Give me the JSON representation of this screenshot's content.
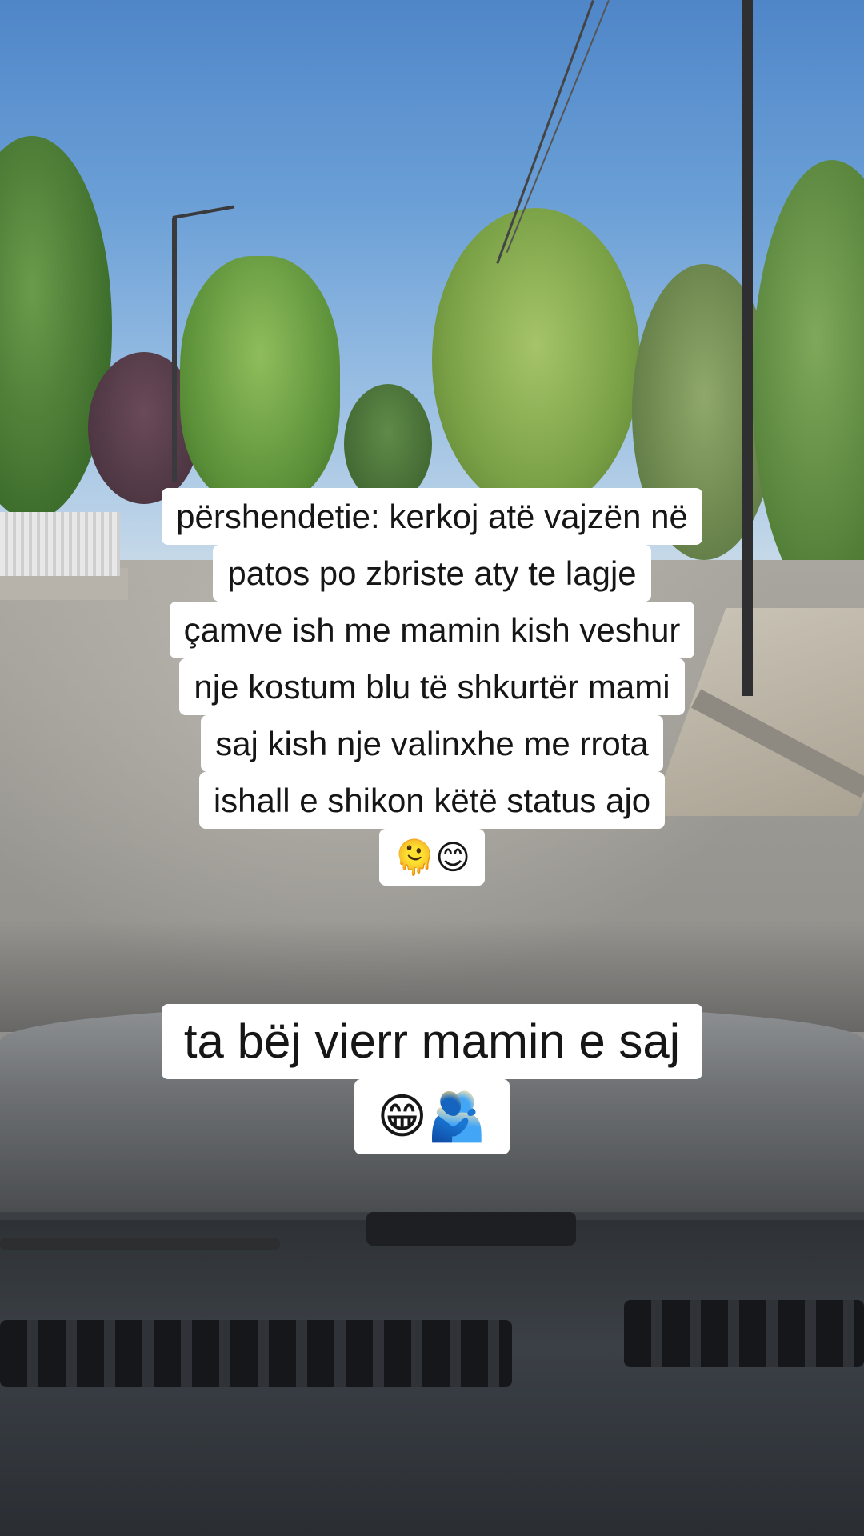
{
  "caption_top": {
    "lines": [
      "përshendetie: kerkoj atë vajzën në",
      "patos po zbriste aty te lagje",
      "çamve ish me mamin kish veshur",
      "nje kostum blu të shkurtër mami",
      "saj kish nje valinxhe me rrota",
      "ishall e shikon këtë status ajo",
      "🫠😊"
    ]
  },
  "caption_bottom": {
    "lines": [
      "ta bëj vierr mamin e saj",
      "😁🫂"
    ]
  }
}
